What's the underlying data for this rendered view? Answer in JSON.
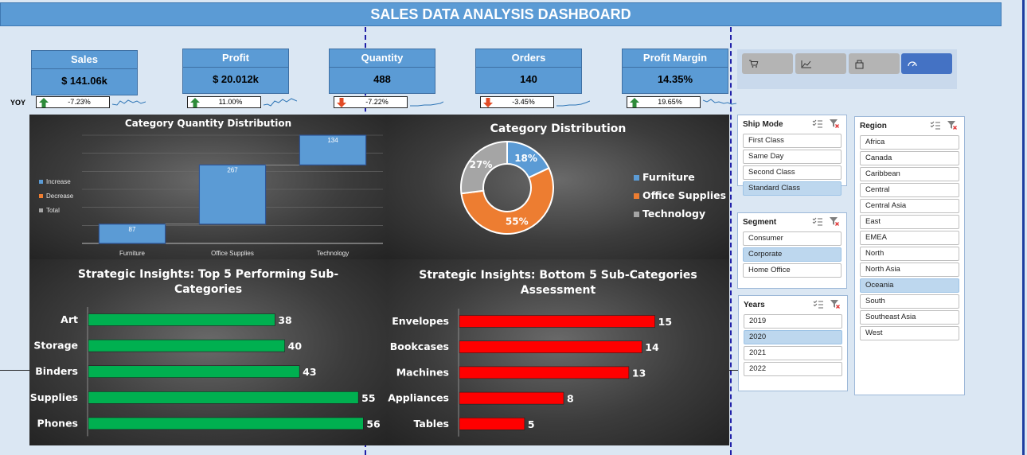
{
  "title": "SALES DATA ANALYSIS DASHBOARD",
  "yoy_label": "YOY",
  "kpis": [
    {
      "title": "Sales",
      "value": "$ 141.06k",
      "yoy": "-7.23%",
      "trend": "up"
    },
    {
      "title": "Profit",
      "value": "$ 20.012k",
      "yoy": "11.00%",
      "trend": "up"
    },
    {
      "title": "Quantity",
      "value": "488",
      "yoy": "-7.22%",
      "trend": "down"
    },
    {
      "title": "Orders",
      "value": "140",
      "yoy": "-3.45%",
      "trend": "down"
    },
    {
      "title": "Profit Margin",
      "value": "14.35%",
      "yoy": "19.65%",
      "trend": "up"
    }
  ],
  "colors": {
    "kpi_blue": "#5b9bd5",
    "up_arrow": "#2e8b3a",
    "down_arrow": "#e24b26",
    "green_bar": "#00b050",
    "red_bar": "#ff0000",
    "selected": "#bdd7ee"
  },
  "nav_buttons": [
    {
      "icon": "cart-icon"
    },
    {
      "icon": "area-chart-icon"
    },
    {
      "icon": "box-icon"
    },
    {
      "icon": "speed-gauge-icon"
    }
  ],
  "charts": {
    "waterfall": {
      "title": "Category Quantity Distribution",
      "legend": [
        "Increase",
        "Decrease",
        "Total"
      ]
    },
    "donut": {
      "title": "Category Distribution",
      "legend": [
        "Furniture",
        "Office Supplies",
        "Technology"
      ]
    },
    "top5": {
      "title_line1": "Strategic Insights: Top 5 Performing Sub-",
      "title_line2": "Categories"
    },
    "bottom5": {
      "title_line1": "Strategic Insights: Bottom 5 Sub-Categories",
      "title_line2": "Assessment"
    }
  },
  "chart_data": [
    {
      "type": "bar",
      "subtype": "waterfall",
      "title": "Category Quantity Distribution",
      "categories": [
        "Furniture",
        "Office Supplies",
        "Technology"
      ],
      "values": [
        87,
        267,
        134
      ],
      "legend": [
        "Increase",
        "Decrease",
        "Total"
      ],
      "ylim": [
        0,
        488
      ]
    },
    {
      "type": "pie",
      "subtype": "donut",
      "title": "Category Distribution",
      "categories": [
        "Furniture",
        "Office Supplies",
        "Technology"
      ],
      "values": [
        18,
        55,
        27
      ],
      "labels": [
        "18%",
        "55%",
        "27%"
      ],
      "colors": [
        "#5b9bd5",
        "#ed7d31",
        "#a5a5a5"
      ],
      "legend_position": "right"
    },
    {
      "type": "bar",
      "orientation": "horizontal",
      "title": "Strategic Insights: Top 5 Performing Sub-Categories",
      "categories": [
        "Art",
        "Storage",
        "Binders",
        "Supplies",
        "Phones"
      ],
      "values": [
        38,
        40,
        43,
        55,
        56
      ],
      "xlim": [
        0,
        60
      ]
    },
    {
      "type": "bar",
      "orientation": "horizontal",
      "title": "Strategic Insights: Bottom 5 Sub-Categories Assessment",
      "categories": [
        "Envelopes",
        "Bookcases",
        "Machines",
        "Appliances",
        "Tables"
      ],
      "values": [
        15,
        14,
        13,
        8,
        5
      ],
      "xlim": [
        0,
        16
      ]
    }
  ],
  "slicers": {
    "ship_mode": {
      "title": "Ship Mode",
      "items": [
        "First Class",
        "Same Day",
        "Second Class",
        "Standard Class"
      ],
      "selected": [
        3
      ]
    },
    "segment": {
      "title": "Segment",
      "items": [
        "Consumer",
        "Corporate",
        "Home Office"
      ],
      "selected": [
        1
      ]
    },
    "years": {
      "title": "Years",
      "items": [
        "2019",
        "2020",
        "2021",
        "2022"
      ],
      "selected": [
        1
      ]
    },
    "region": {
      "title": "Region",
      "items": [
        "Africa",
        "Canada",
        "Caribbean",
        "Central",
        "Central Asia",
        "East",
        "EMEA",
        "North",
        "North Asia",
        "Oceania",
        "South",
        "Southeast Asia",
        "West"
      ],
      "selected": [
        9
      ]
    }
  }
}
